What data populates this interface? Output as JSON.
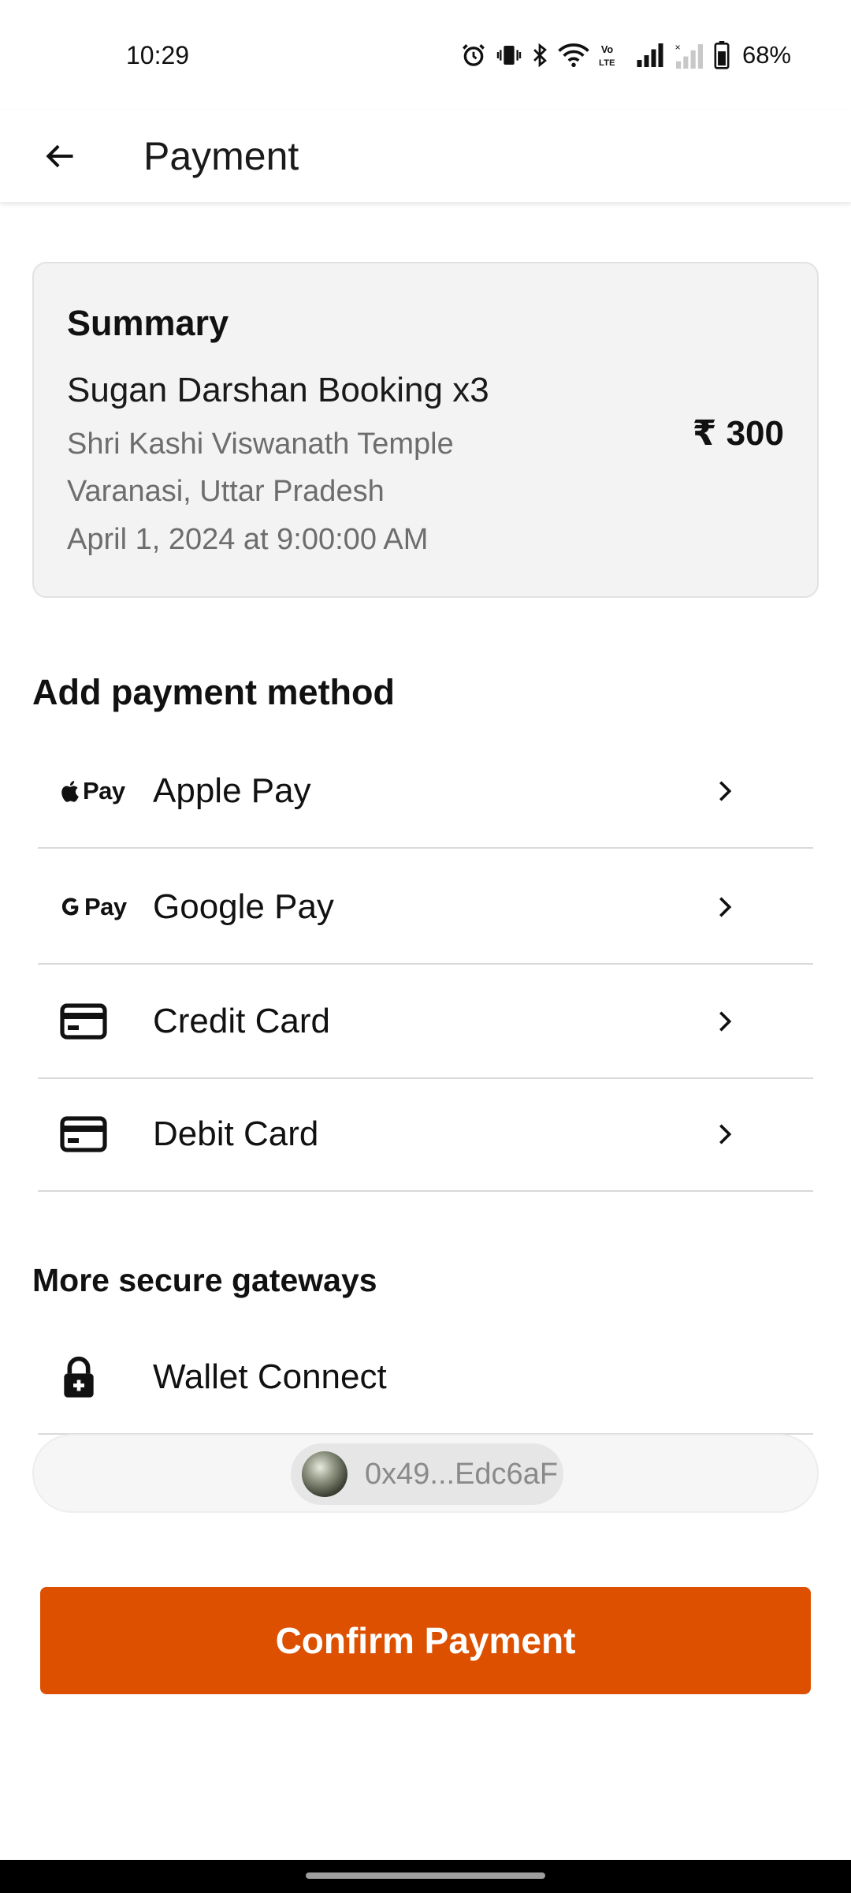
{
  "status_bar": {
    "time": "10:29",
    "battery_percent": "68%",
    "icons": [
      "alarm-icon",
      "vibrate-icon",
      "bluetooth-icon",
      "wifi-icon",
      "volte-icon",
      "signal-icon",
      "signal-no-service-icon",
      "battery-icon"
    ]
  },
  "app_bar": {
    "back_icon": "arrow-left-icon",
    "title": "Payment"
  },
  "summary": {
    "title": "Summary",
    "booking": "Sugan Darshan Booking x3",
    "temple": "Shri Kashi Viswanath Temple",
    "location": "Varanasi, Uttar Pradesh",
    "datetime": "April 1, 2024 at 9:00:00 AM",
    "price": "₹ 300"
  },
  "add_payment": {
    "title": "Add payment method",
    "methods": [
      {
        "label": "Apple Pay",
        "icon": "apple-pay-icon",
        "logo_text": "Pay"
      },
      {
        "label": "Google Pay",
        "icon": "google-pay-icon",
        "logo_text": "Pay"
      },
      {
        "label": "Credit Card",
        "icon": "credit-card-icon"
      },
      {
        "label": "Debit Card",
        "icon": "debit-card-icon"
      }
    ]
  },
  "secure_gateways": {
    "title": "More secure gateways",
    "wallet_connect": {
      "label": "Wallet Connect",
      "icon": "lock-plus-icon"
    },
    "address": "0x49...Edc6aF"
  },
  "confirm_button": {
    "label": "Confirm Payment"
  },
  "colors": {
    "accent": "#dc5000",
    "card_background": "#f3f3f3",
    "divider": "#d9d9d9"
  }
}
